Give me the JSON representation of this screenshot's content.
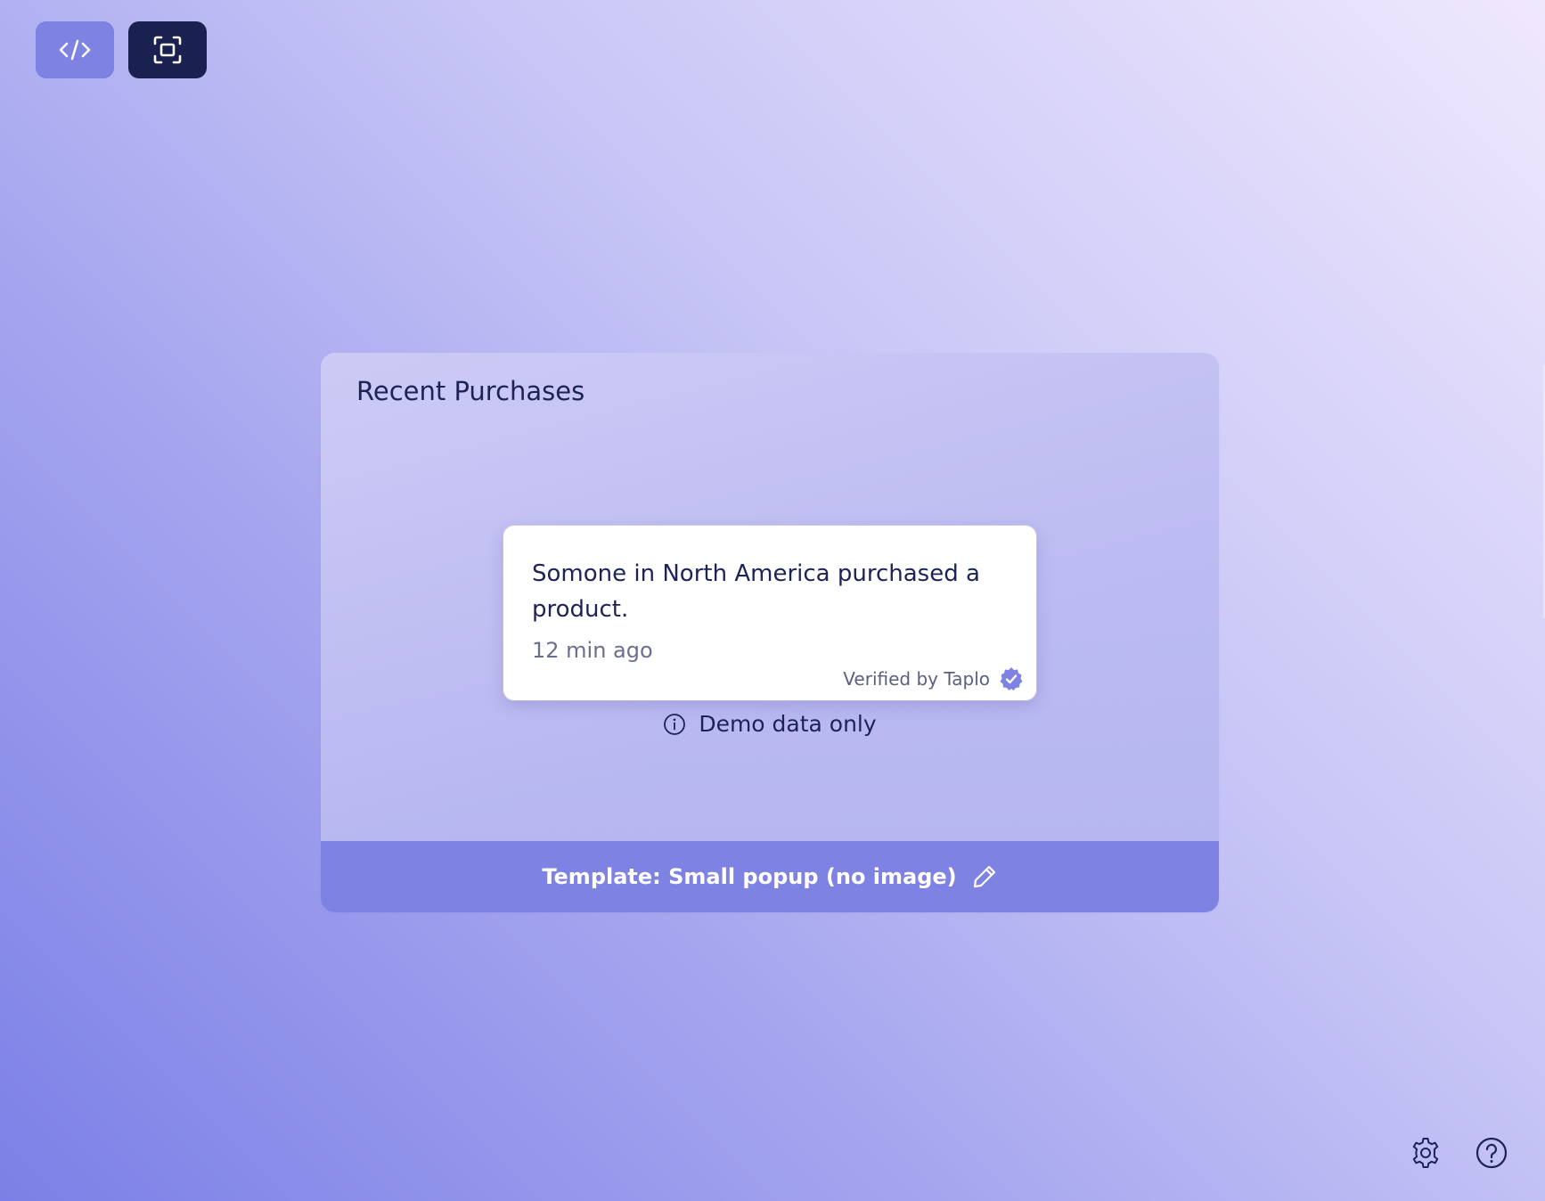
{
  "toolbar": {
    "code_button_icon": "code-icon",
    "capture_button_icon": "capture-frame-icon"
  },
  "panel": {
    "title": "Recent Purchases",
    "popup": {
      "message": "Somone in North America purchased a product.",
      "time": "12 min ago",
      "verified_label": "Verified by Taplo",
      "verified_icon": "verified-badge-icon"
    },
    "demo_note": "Demo data only",
    "footer_label": "Template: Small popup (no image)",
    "footer_icon": "pencil-icon"
  },
  "bottom_icons": [
    "gear-icon",
    "help-circle-icon"
  ],
  "colors": {
    "accent": "#7d82e3",
    "dark": "#1a2150",
    "text": "#1c2457",
    "muted": "#6a6f8f"
  }
}
